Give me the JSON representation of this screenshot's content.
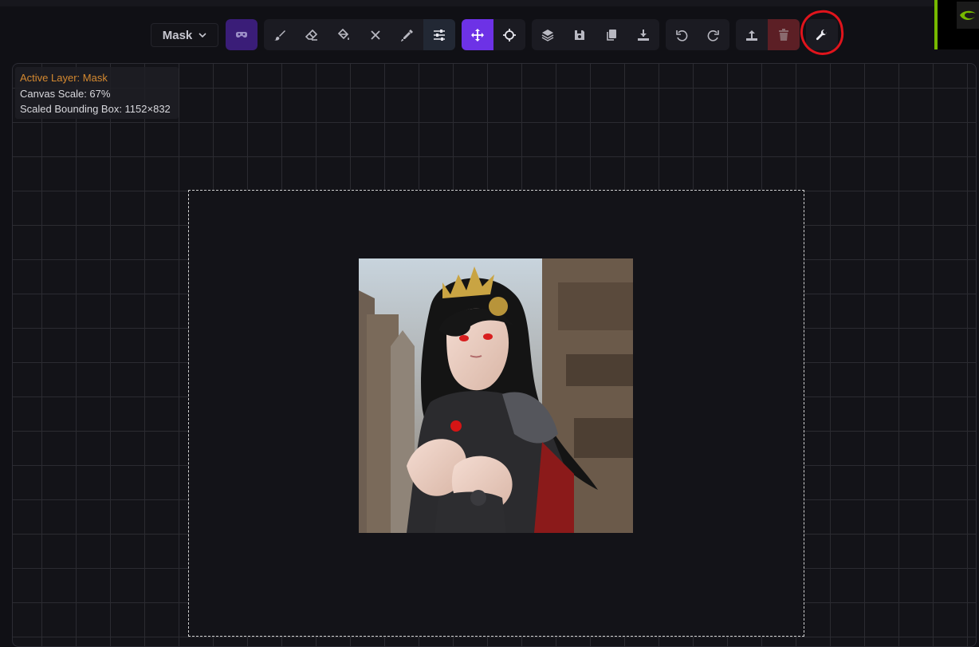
{
  "toolbar": {
    "layer_select": {
      "value": "Mask",
      "icon": "chevron-down-icon"
    },
    "groups": [
      {
        "name": "mask-options",
        "buttons": [
          "mask-icon"
        ]
      },
      {
        "name": "tools",
        "buttons": [
          "brush-icon",
          "eraser-icon",
          "fill-icon",
          "clear-icon",
          "color-picker-icon",
          "settings-sliders-icon"
        ]
      },
      {
        "name": "view",
        "buttons": [
          "move-icon",
          "reset-view-icon"
        ]
      },
      {
        "name": "image-actions",
        "buttons": [
          "merge-layers-icon",
          "save-icon",
          "copy-icon",
          "download-icon"
        ]
      },
      {
        "name": "history",
        "buttons": [
          "undo-icon",
          "redo-icon"
        ]
      },
      {
        "name": "file",
        "buttons": [
          "upload-icon",
          "trash-icon"
        ]
      },
      {
        "name": "settings",
        "buttons": [
          "wrench-icon"
        ]
      }
    ],
    "colors": {
      "accent": "#6d32e6",
      "danger": "#5c1f25",
      "annotation": "#e0141c",
      "brand": "#76b900"
    }
  },
  "canvas": {
    "info": {
      "active_layer": "Active Layer: Mask",
      "scale": "Canvas Scale: 67%",
      "bounding_box": "Scaled Bounding Box: 1152×832"
    },
    "image_alt": "anime style illustration of a dark-haired armored woman"
  }
}
